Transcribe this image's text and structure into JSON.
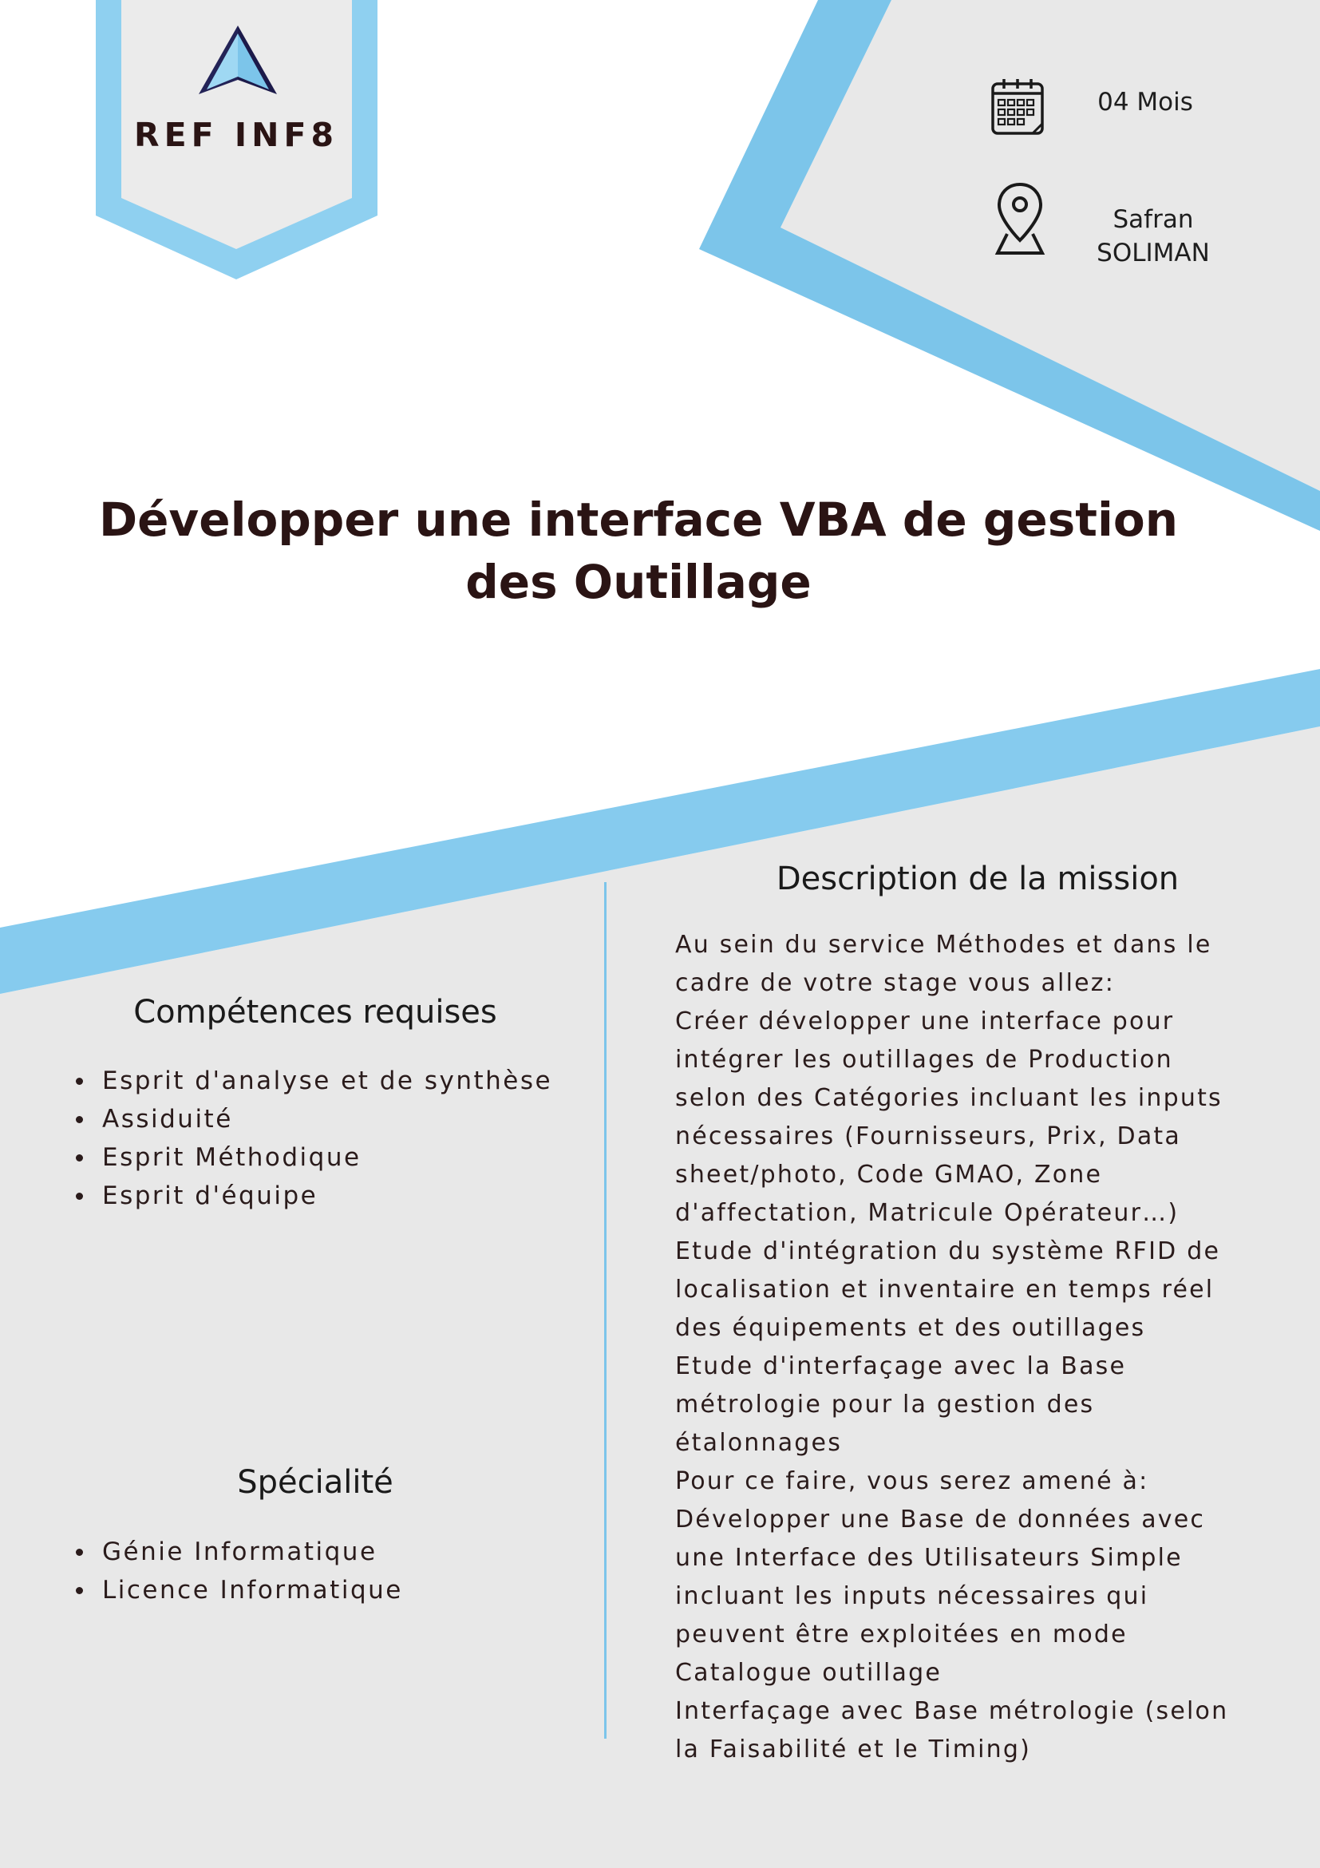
{
  "badge": {
    "label": "REF INF8"
  },
  "info": {
    "duration": "04 Mois",
    "location_line1": "Safran",
    "location_line2": "SOLIMAN"
  },
  "title": {
    "line1": "Développer une interface VBA de gestion",
    "line2": "des Outillage"
  },
  "competences": {
    "heading": "Compétences requises",
    "items": [
      "Esprit d'analyse et de synthèse",
      "Assiduité",
      "Esprit Méthodique",
      "Esprit d'équipe"
    ]
  },
  "specialite": {
    "heading": "Spécialité",
    "items": [
      "Génie Informatique",
      "Licence Informatique"
    ]
  },
  "mission": {
    "heading": "Description de la mission",
    "lines": [
      "Au sein du service Méthodes et dans le",
      "cadre de votre stage vous allez:",
      "Créer développer une interface pour",
      "intégrer les outillages de Production",
      "selon des Catégories incluant les inputs",
      "nécessaires (Fournisseurs, Prix, Data",
      "sheet/photo, Code GMAO, Zone",
      "d'affectation, Matricule Opérateur…)",
      "Etude d'intégration du système RFID de",
      "localisation et inventaire en temps réel",
      "des équipements et des outillages",
      "Etude d'interfaçage avec la Base",
      "métrologie pour la gestion des",
      "étalonnages",
      "Pour ce faire, vous serez amené à:",
      "Développer une Base de données avec",
      "une Interface des Utilisateurs Simple",
      "incluant les inputs nécessaires qui",
      "peuvent être exploitées en mode",
      "Catalogue outillage",
      "Interfaçage avec Base métrologie (selon",
      "la Faisabilité et le Timing)"
    ]
  },
  "colors": {
    "accent_blue": "#7cc5ea",
    "light_gray": "#e8e8e8",
    "title_dark": "#2a1414"
  }
}
